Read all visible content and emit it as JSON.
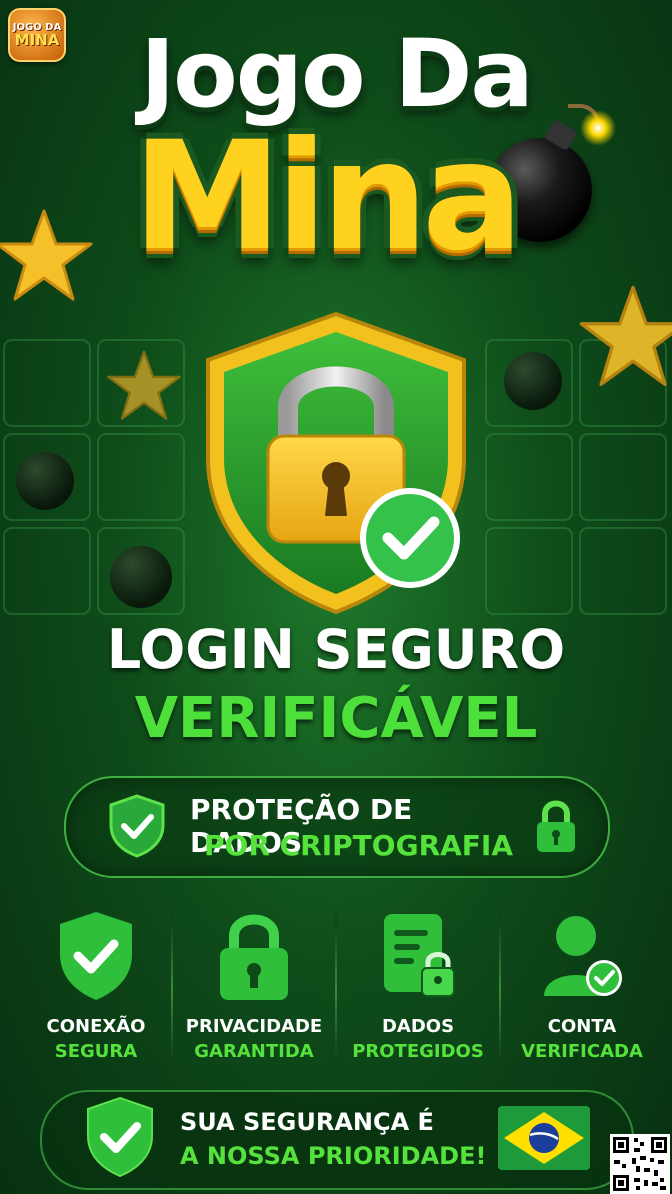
{
  "logo": {
    "line1": "JOGO DA",
    "line2": "MINA"
  },
  "title": {
    "line1": "Jogo Da",
    "line2": "Mina"
  },
  "headline": {
    "line1": "LOGIN SEGURO",
    "line2": "VERIFICÁVEL"
  },
  "protection": {
    "line1": "PROTEÇÃO DE DADOS",
    "line2": "POR CRIPTOGRAFIA"
  },
  "features": [
    {
      "line1": "CONEXÃO",
      "line2": "SEGURA",
      "icon": "shield-check-icon"
    },
    {
      "line1": "PRIVACIDADE",
      "line2": "GARANTIDA",
      "icon": "padlock-icon"
    },
    {
      "line1": "DADOS",
      "line2": "PROTEGIDOS",
      "icon": "document-lock-icon"
    },
    {
      "line1": "CONTA",
      "line2": "VERIFICADA",
      "icon": "user-check-icon"
    }
  ],
  "footer": {
    "line1": "SUA SEGURANÇA É",
    "line2": "A NOSSA PRIORIDADE!"
  },
  "colors": {
    "accent_green": "#56e23c",
    "gold": "#ffd21f",
    "background": "#0f4d1a"
  }
}
